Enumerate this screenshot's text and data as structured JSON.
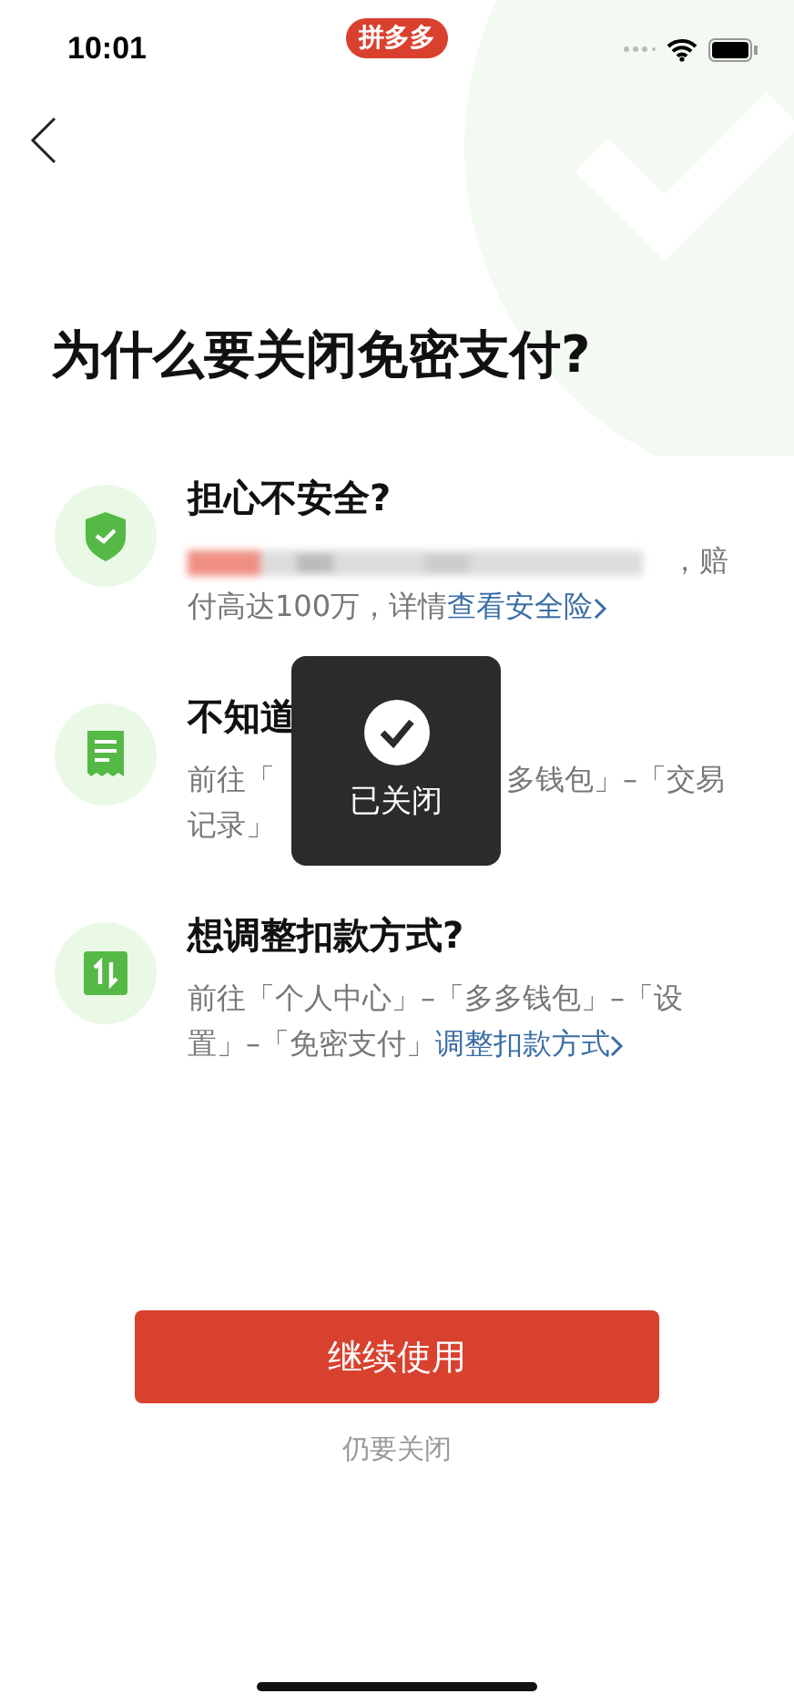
{
  "status_bar": {
    "time": "10:01",
    "app_badge": "拼多多"
  },
  "title": "为什么要关闭免密支付?",
  "reasons": [
    {
      "kind": "shield",
      "heading": "担心不安全?",
      "redacted": true,
      "text": "，赔付高达100万，详情",
      "link": "查看安全险"
    },
    {
      "kind": "receipt",
      "heading": "不知道",
      "description_segments": [
        [
          "前往「",
          "多钱包」–「交易"
        ],
        [
          "记录」"
        ]
      ]
    },
    {
      "kind": "switch",
      "heading": "想调整扣款方式?",
      "text": "前往「个人中心」–「多多钱包」–「设置」–「免密支付」",
      "link": "调整扣款方式"
    }
  ],
  "primary_button": "继续使用",
  "secondary_link": "仍要关闭",
  "toast": {
    "text": "已关闭"
  }
}
